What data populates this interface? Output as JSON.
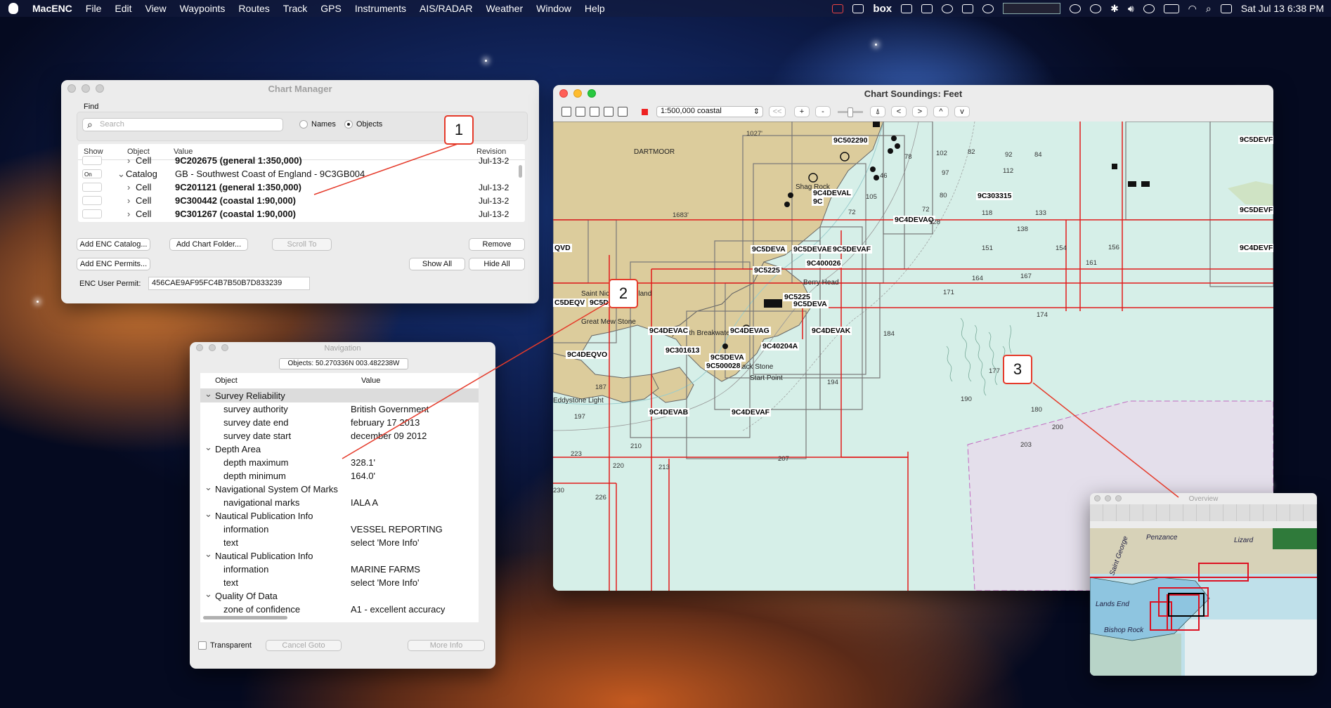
{
  "menubar": {
    "app": "MacENC",
    "items": [
      "File",
      "Edit",
      "View",
      "Waypoints",
      "Routes",
      "Track",
      "GPS",
      "Instruments",
      "AIS/RADAR",
      "Weather",
      "Window",
      "Help"
    ],
    "clock": "Sat Jul 13  6:38 PM",
    "box_label": "box"
  },
  "chart_manager": {
    "title": "Chart Manager",
    "find_label": "Find",
    "search_placeholder": "Search",
    "names_label": "Names",
    "objects_label": "Objects",
    "columns": {
      "show": "Show",
      "object": "Object",
      "value": "Value",
      "revision": "Revision"
    },
    "rows": [
      {
        "show": "",
        "object": "Cell",
        "value": "9C202675 (general 1:350,000)",
        "revision": "Jul-13-2",
        "bold": true,
        "indent": 1
      },
      {
        "show": "On",
        "object": "Catalog",
        "value": "GB - Southwest Coast of England - 9C3GB004",
        "revision": "",
        "bold": false,
        "indent": 0
      },
      {
        "show": "",
        "object": "Cell",
        "value": "9C201121 (general 1:350,000)",
        "revision": "Jul-13-2",
        "bold": true,
        "indent": 1
      },
      {
        "show": "",
        "object": "Cell",
        "value": "9C300442 (coastal 1:90,000)",
        "revision": "Jul-13-2",
        "bold": true,
        "indent": 1
      },
      {
        "show": "",
        "object": "Cell",
        "value": "9C301267 (coastal 1:90,000)",
        "revision": "Jul-13-2",
        "bold": true,
        "indent": 1
      }
    ],
    "buttons": {
      "add_catalog": "Add ENC Catalog...",
      "add_folder": "Add Chart Folder...",
      "scroll_to": "Scroll To",
      "remove": "Remove",
      "add_permits": "Add ENC Permits...",
      "show_all": "Show All",
      "hide_all": "Hide All"
    },
    "permit_label": "ENC User Permit:",
    "permit_value": "456CAE9AF95FC4B7B50B7D833239"
  },
  "navigation": {
    "title": "Navigation",
    "position": "Objects: 50.270336N 003.482238W",
    "columns": {
      "object": "Object",
      "value": "Value"
    },
    "rows": [
      {
        "type": "group",
        "label": "Survey Reliability",
        "value": ""
      },
      {
        "type": "item",
        "label": "survey authority",
        "value": "British Government"
      },
      {
        "type": "item",
        "label": "survey date end",
        "value": "february 17 2013"
      },
      {
        "type": "item",
        "label": "survey date start",
        "value": "december 09 2012"
      },
      {
        "type": "group",
        "label": "Depth Area",
        "value": ""
      },
      {
        "type": "item",
        "label": "depth maximum",
        "value": "328.1'"
      },
      {
        "type": "item",
        "label": "depth minimum",
        "value": "164.0'"
      },
      {
        "type": "group",
        "label": "Navigational System Of Marks",
        "value": ""
      },
      {
        "type": "item",
        "label": "navigational marks",
        "value": "IALA A"
      },
      {
        "type": "group",
        "label": "Nautical Publication Info",
        "value": ""
      },
      {
        "type": "item",
        "label": "information",
        "value": "VESSEL REPORTING"
      },
      {
        "type": "item",
        "label": "text",
        "value": "select 'More Info'"
      },
      {
        "type": "group",
        "label": "Nautical Publication Info",
        "value": ""
      },
      {
        "type": "item",
        "label": "information",
        "value": "MARINE FARMS"
      },
      {
        "type": "item",
        "label": "text",
        "value": "select 'More Info'"
      },
      {
        "type": "group",
        "label": "Quality Of Data",
        "value": ""
      },
      {
        "type": "item",
        "label": "zone of confidence",
        "value": "A1 - excellent accuracy"
      }
    ],
    "transparent_label": "Transparent",
    "cancel_goto": "Cancel Goto",
    "more_info": "More Info"
  },
  "chart": {
    "title": "Chart  Soundings: Feet",
    "scale": "1:500,000 coastal",
    "toolbar": {
      "back": "<<",
      "plus": "+",
      "minus": "-",
      "left": "<",
      "right": ">",
      "up": "^",
      "down": "v"
    },
    "place_labels": [
      "DARTMOOR",
      "Shag Rock",
      "Berry Head",
      "Black Stone",
      "Start Point",
      "Great Mew Stone",
      "Eddystone Light",
      "Saint Nicholas's Island",
      "Plymouth Breakwater"
    ],
    "cell_labels": [
      "9C502290",
      "9C4DEVAL",
      "9C",
      "9C4DEVAQ",
      "9C303315",
      "9C5DEVA",
      "9C5DEVAE",
      "9C5DEVAF",
      "9C400026",
      "9C5225",
      "9C5225",
      "9C5DEVA",
      "C5DEQV",
      "9C5DEQV",
      "9C4DEVAC",
      "9C4DEVAG",
      "9C4DEVAK",
      "9C40204A",
      "9C301613",
      "9C5DEVA",
      "9C500028",
      "9C4DEQVO",
      "9C4DEVAB",
      "9C4DEVAF",
      "QVD",
      "9C5DEVF",
      "9C5DEVF",
      "9C4DEVF"
    ],
    "soundings": [
      "1027'",
      "1683'",
      "46",
      "72",
      "80",
      "97",
      "112",
      "118",
      "133",
      "138",
      "151",
      "154",
      "156",
      "161",
      "164",
      "167",
      "171",
      "174",
      "177",
      "184",
      "187",
      "190",
      "194",
      "197",
      "200",
      "203",
      "207",
      "210",
      "213",
      "220",
      "223",
      "226",
      "230",
      "72",
      "82",
      "84",
      "92",
      "102",
      "128",
      "78",
      "180",
      "105"
    ]
  },
  "overview": {
    "title": "Overview",
    "labels": [
      "Lands End",
      "Bishop Rock",
      "Penzance",
      "Lizard",
      "Saint George"
    ]
  },
  "callouts": [
    "1",
    "2",
    "3"
  ]
}
